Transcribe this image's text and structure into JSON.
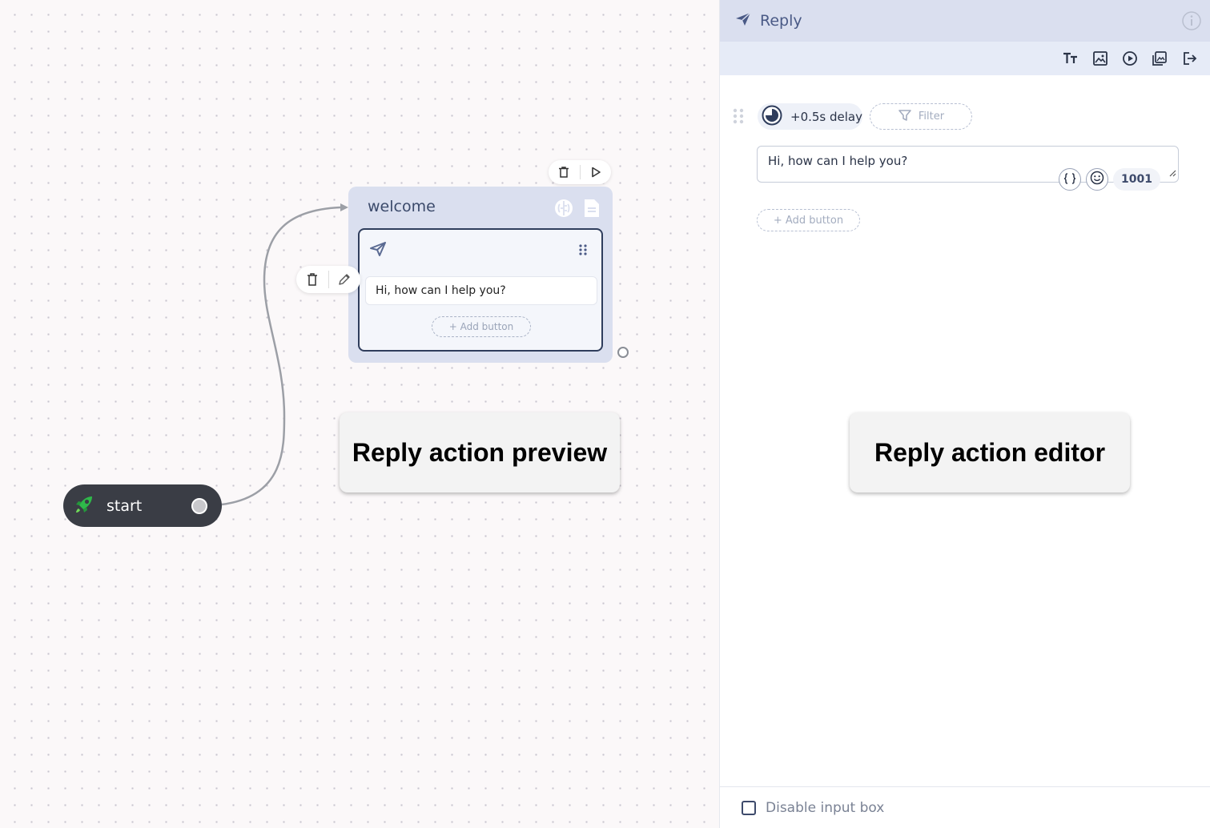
{
  "canvas": {
    "start_node": {
      "label": "start"
    },
    "welcome_node": {
      "title": "welcome",
      "reply_action": {
        "message": "Hi, how can I help you?",
        "add_button_label": "+ Add button"
      }
    },
    "callouts": {
      "preview": "Reply action preview",
      "editor": "Reply action editor"
    }
  },
  "editor": {
    "title": "Reply",
    "toolbar": [
      "text-format-icon",
      "image-icon",
      "video-icon",
      "gallery-icon",
      "redirect-icon"
    ],
    "delay_label": "+0.5s delay",
    "filter_label": "Filter",
    "message_value": "Hi, how can I help you?",
    "char_counter": "1001",
    "add_button_label": "+ Add button",
    "disable_input_label": "Disable input box"
  },
  "colors": {
    "header_bg": "#dadfef",
    "toolbar_bg": "#e6ebf7",
    "node_border": "#2f3d5c",
    "start_node_bg": "#3a3d45",
    "accent_text": "#4a5a86"
  }
}
